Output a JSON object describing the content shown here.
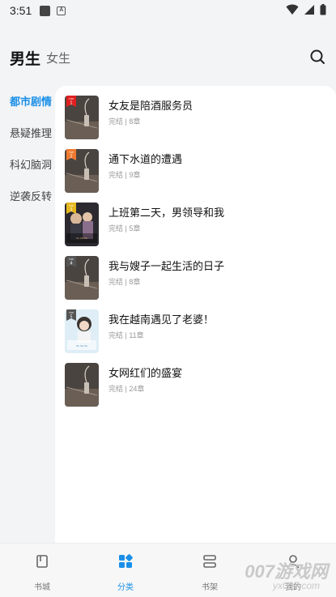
{
  "status_bar": {
    "time": "3:51"
  },
  "header": {
    "tab_active": "男生",
    "tab_inactive": "女生"
  },
  "sidebar": {
    "items": [
      {
        "label": "都市剧情",
        "active": true
      },
      {
        "label": "悬疑推理",
        "active": false
      },
      {
        "label": "科幻脑洞",
        "active": false
      },
      {
        "label": "逆袭反转",
        "active": false
      }
    ]
  },
  "books": [
    {
      "title": "女友是陪酒服务员",
      "meta": "完结 | 8章",
      "rank": "1"
    },
    {
      "title": "通下水道的遭遇",
      "meta": "完结 | 9章",
      "rank": "2"
    },
    {
      "title": "上班第二天，男领导和我",
      "meta": "完结 | 5章",
      "rank": "3"
    },
    {
      "title": "我与嫂子一起生活的日子",
      "meta": "完结 | 8章",
      "rank": "4"
    },
    {
      "title": "我在越南遇见了老婆！",
      "meta": "完结 | 11章",
      "rank": "5"
    },
    {
      "title": "女网红们的盛宴",
      "meta": "完结 | 24章",
      "rank": ""
    }
  ],
  "bottom_nav": {
    "items": [
      {
        "label": "书城",
        "icon": "book-icon"
      },
      {
        "label": "分类",
        "icon": "category-icon",
        "active": true
      },
      {
        "label": "书架",
        "icon": "shelf-icon"
      },
      {
        "label": "我的",
        "icon": "profile-icon"
      }
    ]
  },
  "watermark": {
    "big": "007游戏网",
    "small": "yx007.com"
  },
  "colors": {
    "accent": "#1a8fe8",
    "background": "#f3f4f6"
  }
}
